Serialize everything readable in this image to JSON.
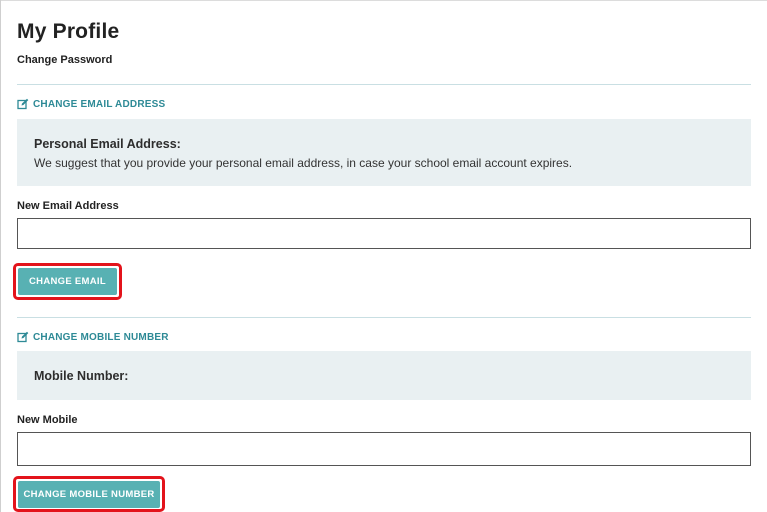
{
  "page": {
    "title": "My Profile",
    "change_password_link": "Change Password"
  },
  "email_section": {
    "heading": "CHANGE EMAIL ADDRESS",
    "heading_icon": "edit-icon",
    "info_title": "Personal Email Address:",
    "info_text": "We suggest that you provide your personal email address, in case your school email account expires.",
    "field_label": "New Email Address",
    "field_value": "",
    "button_label": "CHANGE EMAIL"
  },
  "mobile_section": {
    "heading": "CHANGE MOBILE NUMBER",
    "heading_icon": "edit-icon",
    "info_title": "Mobile Number:",
    "field_label": "New Mobile",
    "field_value": "",
    "button_label": "CHANGE MOBILE NUMBER"
  },
  "colors": {
    "accent": "#2e8a96",
    "button": "#58b1b3",
    "info_box": "#e9f0f2",
    "highlight": "#e3131b"
  }
}
